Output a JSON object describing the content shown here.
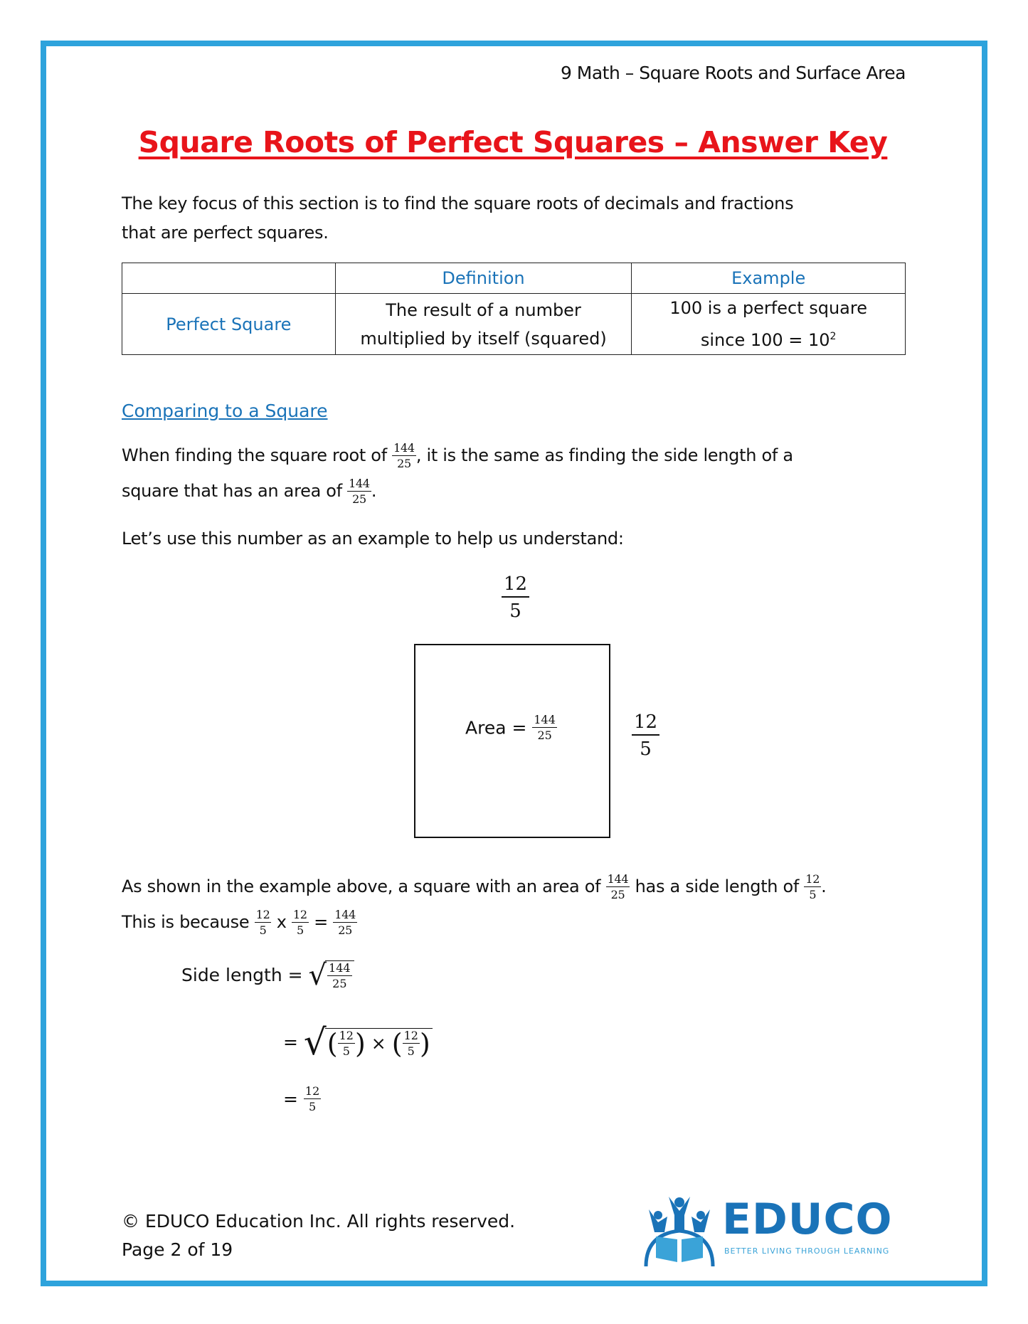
{
  "header": {
    "course": "9 Math – Square Roots and Surface Area"
  },
  "title": "Square Roots of Perfect Squares – Answer Key",
  "intro": {
    "line1": "The key focus of this section is to find the square roots of decimals and fractions",
    "line2": "that are perfect squares."
  },
  "table": {
    "headers": [
      "",
      "Definition",
      "Example"
    ],
    "row": {
      "term": "Perfect Square",
      "definition_line1": "The result of a number",
      "definition_line2": "multiplied by itself (squared)",
      "example_line1": "100 is a perfect square",
      "example_line2": "since  100 = 10",
      "example_exponent": "2"
    }
  },
  "section": {
    "heading": "Comparing to a Square",
    "p1_a": "When finding the square root of ",
    "p1_b": ", it is the same as finding the side length of a",
    "p2_a": "square that has an area of ",
    "p2_b": ".",
    "p3": "Let’s use this number as an example to help us understand:"
  },
  "fractions": {
    "area": {
      "num": "144",
      "den": "25"
    },
    "side": {
      "num": "12",
      "den": "5"
    }
  },
  "diagram": {
    "area_label": "Area = "
  },
  "explanation": {
    "l1_a": "As shown in the example above, a square with an area of ",
    "l1_b": " has a side length of ",
    "l1_c": ".",
    "l2_a": "This is because ",
    "times": "x",
    "equals": "="
  },
  "derivation": {
    "label": "Side length =",
    "eq": "=",
    "times": "×",
    "lparen": "(",
    "rparen": ")"
  },
  "footer": {
    "copyright": "© EDUCO Education Inc. All rights reserved.",
    "page": "Page 2 of 19"
  },
  "logo": {
    "word": "EDUCO",
    "tagline": "BETTER LIVING THROUGH LEARNING"
  },
  "colors": {
    "border": "#2ea3dc",
    "title": "#e8141a",
    "accent": "#1a73b8"
  }
}
